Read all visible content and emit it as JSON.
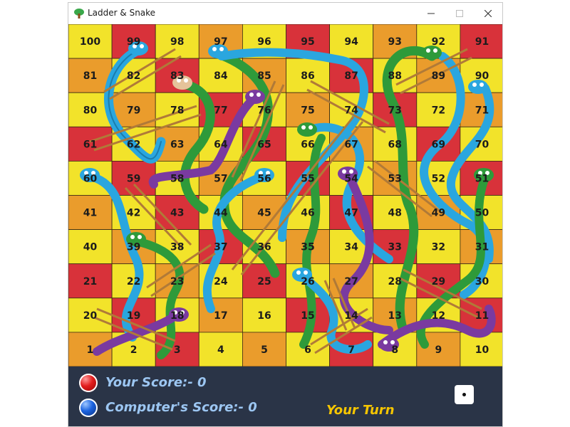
{
  "window": {
    "title": "Ladder & Snake",
    "minimize_label": "Minimize",
    "maximize_label": "Maximize",
    "close_label": "Close"
  },
  "board": {
    "cells": [
      100,
      99,
      98,
      97,
      96,
      95,
      94,
      93,
      92,
      91,
      81,
      82,
      83,
      84,
      85,
      86,
      87,
      88,
      89,
      90,
      80,
      79,
      78,
      77,
      76,
      75,
      74,
      73,
      72,
      71,
      61,
      62,
      63,
      64,
      65,
      66,
      67,
      68,
      69,
      70,
      60,
      59,
      58,
      57,
      56,
      55,
      54,
      53,
      52,
      51,
      41,
      42,
      43,
      44,
      45,
      46,
      47,
      48,
      49,
      50,
      40,
      39,
      38,
      37,
      36,
      35,
      34,
      33,
      32,
      31,
      21,
      22,
      23,
      24,
      25,
      26,
      27,
      28,
      29,
      30,
      20,
      19,
      18,
      17,
      16,
      15,
      14,
      13,
      12,
      11,
      1,
      2,
      3,
      4,
      5,
      6,
      7,
      8,
      9,
      10
    ],
    "colors": {
      "yellow": "#f2e32a",
      "orange": "#ea9c2c",
      "red": "#d8323a",
      "grid": "#3a2a14",
      "number": "#1c1c1c",
      "snake_blue": "#2aa6df",
      "snake_green": "#2e9a3a",
      "snake_purple": "#7a3aa0",
      "ladder": "#c8904a"
    }
  },
  "bottom": {
    "your_score": "Your Score:- 0",
    "computer_score": "Computer's Score:- 0",
    "turn": "Your Turn",
    "dice_value": 1
  }
}
